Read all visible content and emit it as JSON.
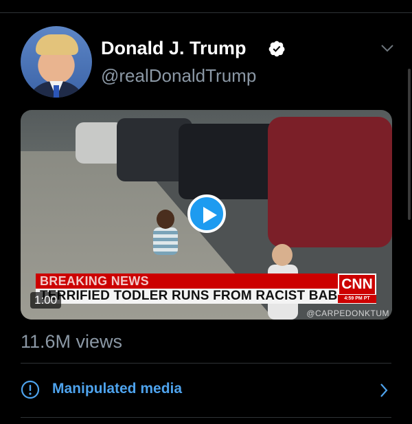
{
  "author": {
    "display_name": "Donald J. Trump",
    "handle": "@realDonaldTrump",
    "verified_icon": "verified-badge-icon"
  },
  "media": {
    "duration": "1:00",
    "play_icon": "play-icon",
    "chyron": {
      "breaking": "BREAKING NEWS",
      "headline": "TERRIFIED TODLER RUNS FROM RACIST BABY",
      "network": "CNN",
      "time": "4:59 PM PT"
    },
    "watermark": "@CARPEDONKTUM"
  },
  "stats": {
    "views": "11.6M views"
  },
  "notice": {
    "label": "Manipulated media",
    "icon": "exclamation-circle-icon"
  },
  "colors": {
    "background": "#000000",
    "link": "#4ea3ed",
    "secondary_text": "#8b98a5",
    "play_button": "#1d9bf0"
  }
}
